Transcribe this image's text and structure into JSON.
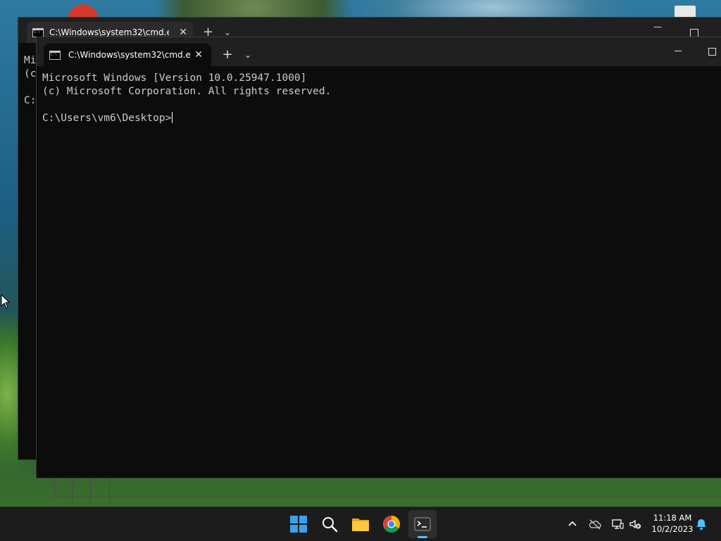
{
  "background_window": {
    "tab_title": "C:\\Windows\\system32\\cmd.e",
    "partial_lines": [
      "Mi",
      "(c",
      "",
      "C:"
    ]
  },
  "window": {
    "tab_title": "C:\\Windows\\system32\\cmd.e",
    "tab_close": "✕",
    "new_tab": "+",
    "dropdown": "⌄"
  },
  "terminal": {
    "lines": [
      "Microsoft Windows [Version 10.0.25947.1000]",
      "(c) Microsoft Corporation. All rights reserved.",
      "",
      "C:\\Users\\vm6\\Desktop>"
    ]
  },
  "taskbar": {
    "apps": [
      "start-icon",
      "search-icon",
      "file-explorer-icon",
      "chrome-icon",
      "terminal-icon"
    ],
    "active_app": "terminal-icon",
    "accent": "#4cc2ff"
  },
  "tray": {
    "time": "11:18 AM",
    "date": "10/2/2023",
    "icons": [
      "chevron-up-icon",
      "cloud-offline-icon",
      "network-icon",
      "volume-muted-icon",
      "notification-bell-icon"
    ]
  }
}
